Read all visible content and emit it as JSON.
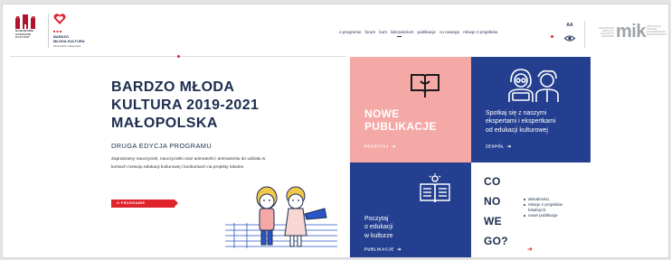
{
  "header": {
    "logo_mck_text": [
      "NARODOWE",
      "CENTRUM",
      "KULTURY"
    ],
    "logo_bmk_text": [
      "BARDZO",
      "MŁODA KULTURA"
    ],
    "logo_bmk_sub": "2019-2021 małopolska",
    "nav": [
      "o programie",
      "forum",
      "kurs",
      "laboratorium",
      "publikacje",
      "co nowego",
      "relacje z projektów"
    ],
    "aa_label": "AA",
    "mik_logo": "mik",
    "mik_small_left": "MAŁOPOLSKI INSTYTUT KULTURY W KRAKOWIE",
    "mik_small_right": "INSTYTUCJA KULTURY WOJEWÓDZTWA MAŁOPOLSKIEGO"
  },
  "hero": {
    "title_lines": [
      "BARDZO MŁODA",
      "KULTURA 2019-2021",
      "MAŁOPOLSKA"
    ],
    "subtitle": "DRUGA EDYCJA PROGRAMU",
    "description": "Zapraszamy nauczycieli, nauczycielki oraz animatorki i animatorów do udziału w kursach rozwoju edukacji kulturowej i konkursach na projekty lokalne.",
    "button_label": "O PROGRAMIE"
  },
  "tiles": {
    "publikacje": {
      "title_lines": [
        "NOWE",
        "PUBLIKACJE"
      ],
      "cta": "POCZYTAJ"
    },
    "eksperci": {
      "text_lines": [
        "Spotkaj się z naszymi",
        "ekspertami i ekspertkami",
        "od edukacji kulturowej"
      ],
      "cta": "ZESPÓŁ"
    },
    "edukacja": {
      "text_lines": [
        "Poczytaj",
        "o edukacji",
        "w kulturze"
      ],
      "cta": "PUBLIKACJE"
    },
    "co_nowego": {
      "words": [
        "CO",
        "NO",
        "WE",
        "GO?"
      ],
      "items": [
        "aktualności,",
        "relacje z projektów lokalnych,",
        "nowe publikacje"
      ]
    }
  },
  "colors": {
    "navy": "#243f8f",
    "pink": "#f4a9a6",
    "red": "#e0242e",
    "text_dark": "#1c2d4f"
  },
  "icons": [
    "castle-logo-icon",
    "heart-logo-icon",
    "eye-icon",
    "book-icon",
    "people-icon",
    "open-book-icon",
    "arrow-right-icon",
    "kids-illustration"
  ]
}
